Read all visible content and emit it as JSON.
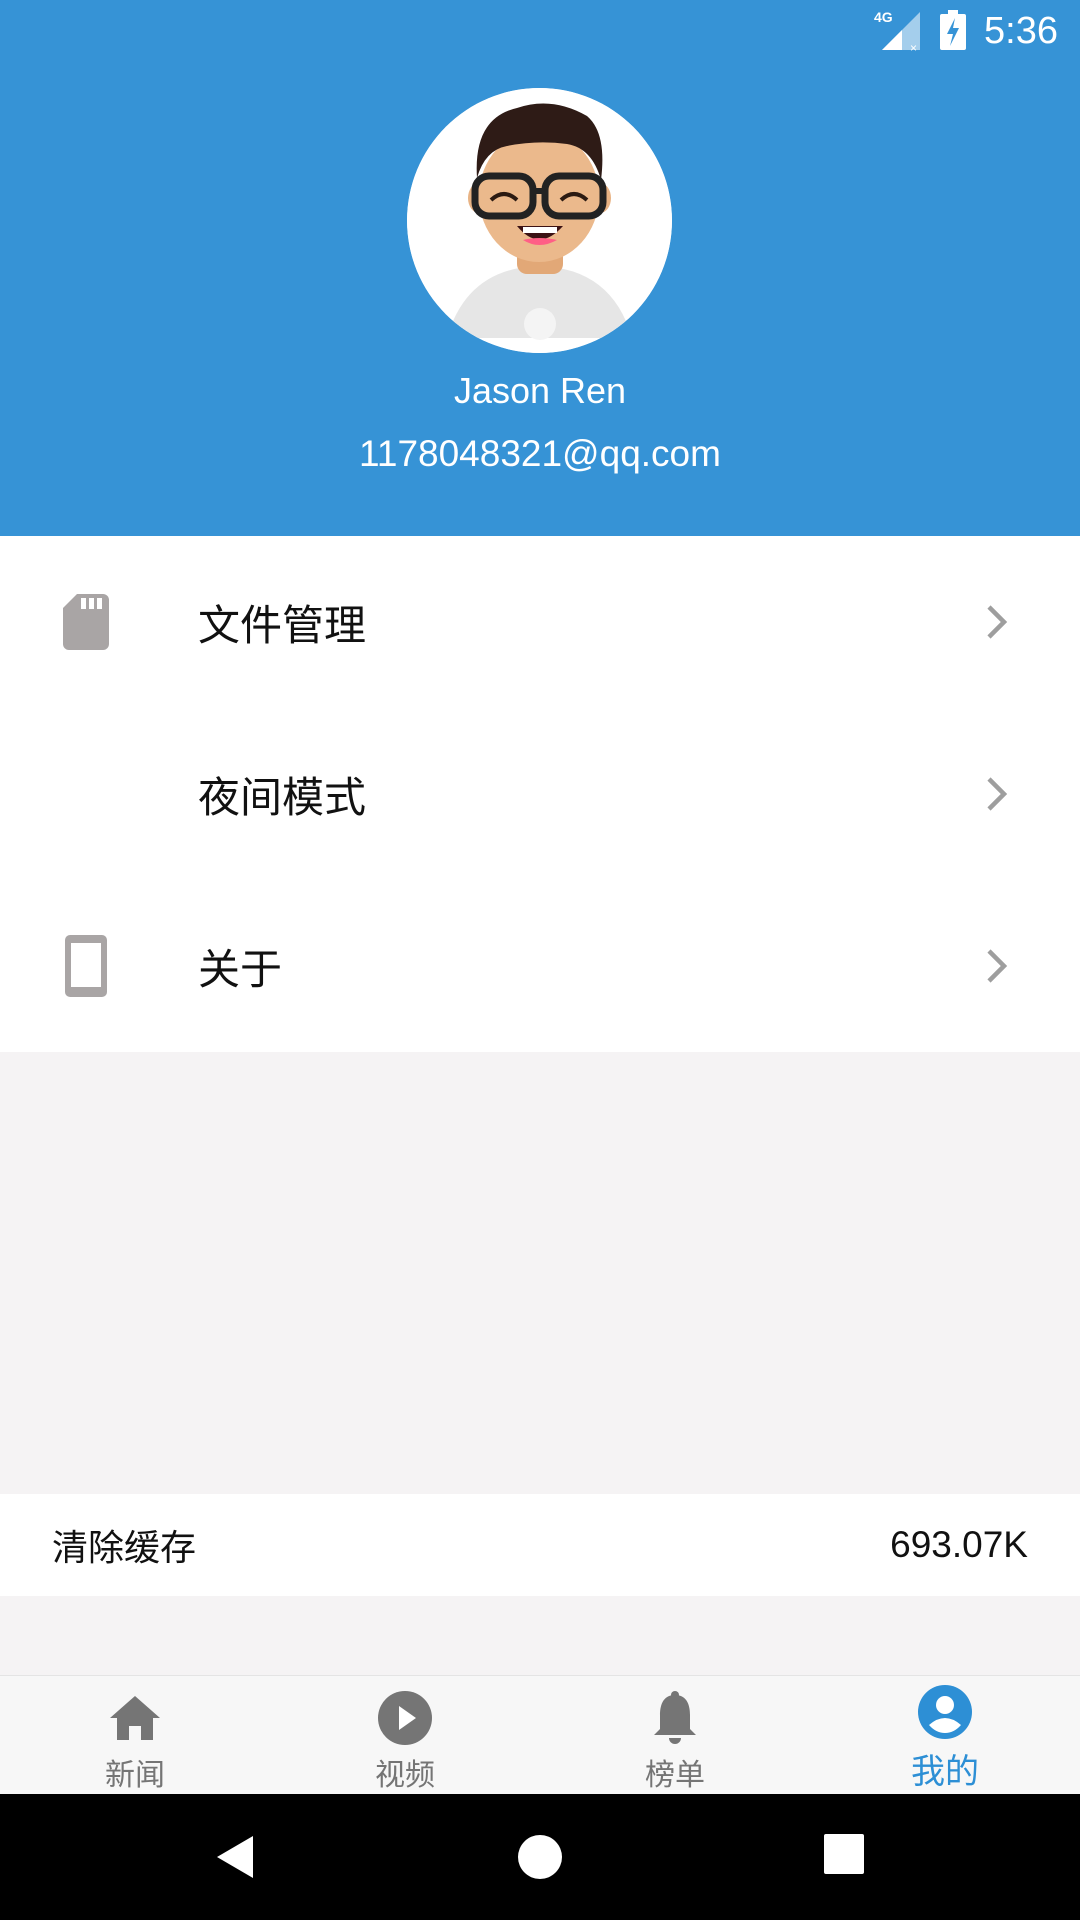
{
  "status_bar": {
    "network_label": "4G",
    "time": "5:36",
    "icons": [
      "signal-4g-icon",
      "battery-charging-icon"
    ]
  },
  "profile": {
    "name": "Jason Ren",
    "email": "1178048321@qq.com",
    "avatar_icon": "avatar-illustration",
    "header_color": "#3693d6"
  },
  "menu": {
    "items": [
      {
        "label": "文件管理",
        "icon": "sd-card-icon"
      },
      {
        "label": "夜间模式",
        "icon": "moon-icon"
      },
      {
        "label": "关于",
        "icon": "phone-icon"
      }
    ]
  },
  "cache": {
    "label": "清除缓存",
    "value": "693.07K"
  },
  "bottom_nav": {
    "items": [
      {
        "label": "新闻",
        "icon": "home-icon",
        "active": false
      },
      {
        "label": "视频",
        "icon": "play-circle-icon",
        "active": false
      },
      {
        "label": "榜单",
        "icon": "bell-icon",
        "active": false
      },
      {
        "label": "我的",
        "icon": "account-circle-icon",
        "active": true
      }
    ],
    "active_color": "#2d8fd5"
  },
  "system_nav": [
    "back-icon",
    "home-circle-icon",
    "recents-icon"
  ]
}
